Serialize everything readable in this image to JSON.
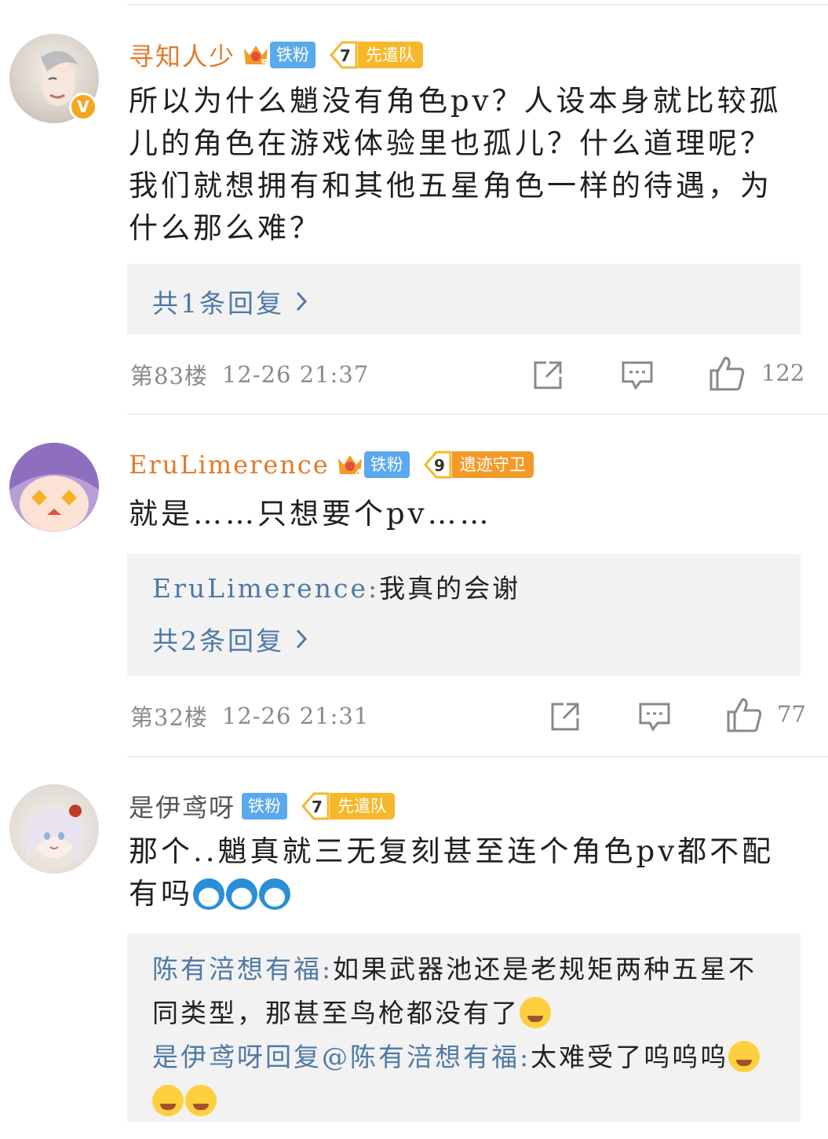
{
  "comments": [
    {
      "username": "寻知人少",
      "fan_level": "5",
      "fan_label": "铁粉",
      "rank_level": "7",
      "rank_label": "先遣队",
      "verified": "V",
      "text": "所以为什么魈没有角色pv？人设本身就比较孤儿的角色在游戏体验里也孤儿？什么道理呢？我们就想拥有和其他五星角色一样的待遇，为什么那么难？",
      "reply_count_link": "共1条回复",
      "floor": "第83楼",
      "time": "12-26 21:37",
      "likes": "122"
    },
    {
      "username": "EruLimerence",
      "fan_level": "4",
      "fan_label": "铁粉",
      "rank_level": "9",
      "rank_label": "遗迹守卫",
      "text": "就是……只想要个pv……",
      "reply_preview": {
        "who": "EruLimerence",
        "sep": ":",
        "text": "我真的会谢"
      },
      "reply_count_link": "共2条回复",
      "floor": "第32楼",
      "time": "12-26 21:31",
      "likes": "77"
    },
    {
      "username": "是伊鸢呀",
      "fan_label": "铁粉",
      "rank_level": "7",
      "rank_label": "先遣队",
      "text": "那个..魈真就三无复刻甚至连个角色pv都不配有吗",
      "emoji": "doraemon-crying",
      "replies": [
        {
          "who": "陈有涪想有福",
          "sep": ":",
          "text": "如果武器池还是老规矩两种五星不同类型，那甚至鸟枪都没有了"
        },
        {
          "who": "是伊鸢呀回复@陈有涪想有福",
          "sep": ":",
          "text": "太难受了呜呜呜"
        }
      ]
    }
  ],
  "icons": [
    "share-icon",
    "comment-icon",
    "like-icon",
    "chevron-right-icon"
  ],
  "colors": {
    "username_orange": "#e07a2b",
    "link_blue": "#4e79a8",
    "fan_blue": "#5aa9ee",
    "rank_gold": "#f6b82b",
    "muted": "#8a8a8a"
  }
}
